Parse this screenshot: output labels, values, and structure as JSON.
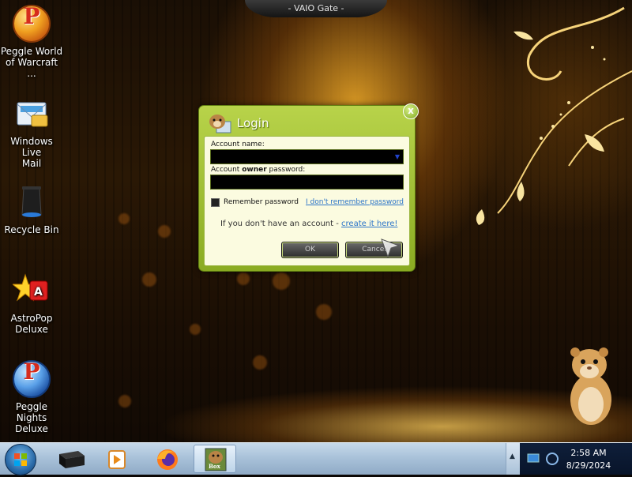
{
  "window_title": "- VAIO Gate -",
  "desktop_icons": [
    {
      "label_line1": "Peggle World",
      "label_line2": "of Warcraft ...",
      "icon": "peggle-icon"
    },
    {
      "label_line1": "Windows Live",
      "label_line2": "Mail",
      "icon": "mail-icon"
    },
    {
      "label_line1": "Recycle Bin",
      "label_line2": "",
      "icon": "recycle-bin-icon"
    },
    {
      "label_line1": "AstroPop",
      "label_line2": "Deluxe",
      "icon": "astropop-icon"
    },
    {
      "label_line1": "Peggle Nights",
      "label_line2": "Deluxe",
      "icon": "peggle-nights-icon"
    }
  ],
  "login": {
    "title": "Login",
    "close_label": "x",
    "account_name_label": "Account name:",
    "account_name_value": "",
    "password_label_pre": "Account ",
    "password_label_bold": "owner",
    "password_label_post": " password:",
    "password_value": "",
    "remember_label": "Remember password",
    "remember_checked": false,
    "forgot_link": "I don't remember password",
    "no_account_text": "If you don't have an account - ",
    "create_link": "create it here!",
    "ok_label": "OK",
    "cancel_label": "Cancel"
  },
  "taskbar": {
    "items": [
      "black-box-icon",
      "media-player-icon",
      "firefox-icon",
      "hamster-box-icon"
    ],
    "active_item": "hamster-box-icon",
    "hamster_box_label": "Box"
  },
  "clock": {
    "time": "2:58 AM",
    "date": "8/29/2024"
  },
  "colors": {
    "dialog_green": "#9dbd30",
    "dialog_panel": "#fbfbe0",
    "link": "#2c74c8",
    "taskbar": "#a7c0d8"
  }
}
